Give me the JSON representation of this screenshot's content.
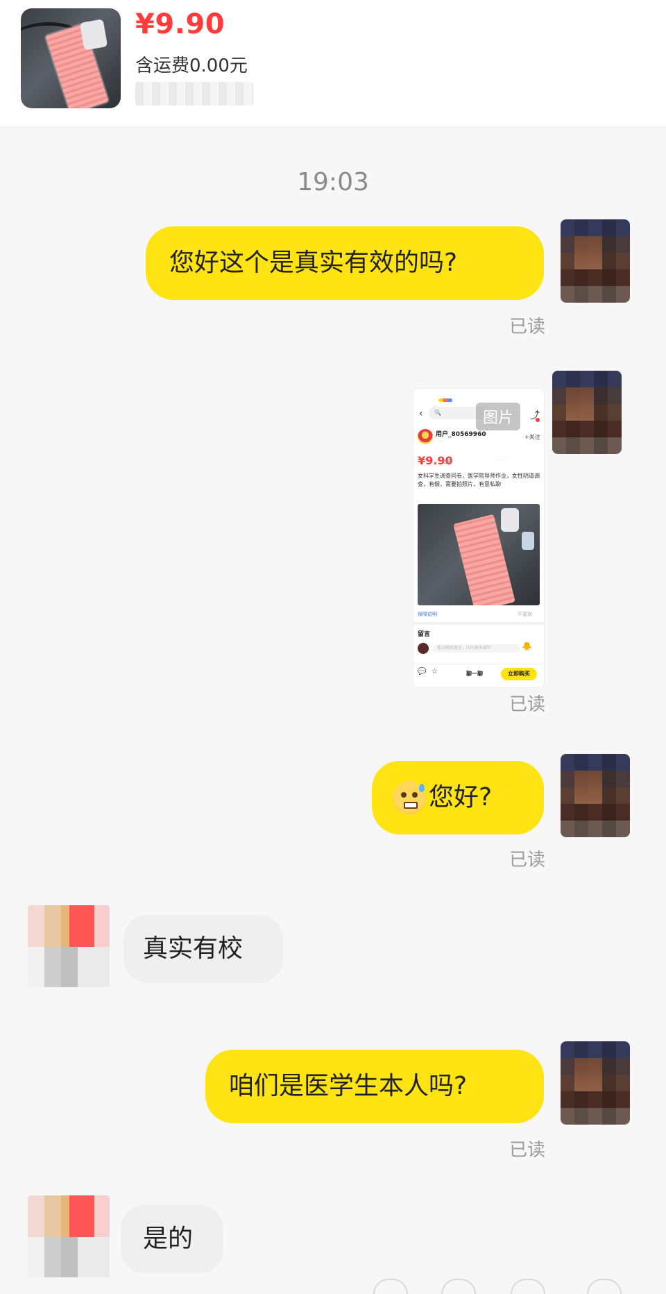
{
  "product": {
    "price": "¥9.90",
    "shipping": "含运费0.00元"
  },
  "chat": {
    "timestamp": "19:03",
    "messages": [
      {
        "from": "me",
        "text": "您好这个是真实有效的吗?",
        "status": "已读"
      },
      {
        "from": "me",
        "type": "image",
        "tag": "图片",
        "status": "已读"
      },
      {
        "from": "me",
        "text": "您好?",
        "emoji": "anxious-sweat-face",
        "status": "已读"
      },
      {
        "from": "them",
        "text": "真实有校"
      },
      {
        "from": "me",
        "text": "咱们是医学生本人吗?",
        "status": "已读"
      },
      {
        "from": "them",
        "text": "是的"
      }
    ]
  },
  "shared_screenshot": {
    "user": "用户_80569960",
    "follow": "+关注",
    "price": "¥9.90",
    "price_sub": "包邮",
    "description": "女科学生调查问卷，医学院导师作业，女性阴道调查，有偿，需要拍照片，有意私聊",
    "link_left": "保障说明",
    "link_right": "不喜欢",
    "comments_title": "留言",
    "comment_placeholder": "看对眼就留言，问问更多细节",
    "ask_label": "聊一聊",
    "buy_label": "立即购买",
    "nav_left": "小窗",
    "nav_right": "收藏"
  },
  "colors": {
    "bubble_out": "#ffe313",
    "bubble_in": "#efefef",
    "price_red": "#ff3b3b"
  },
  "icons": [
    "anxious-sweat-face-icon",
    "back-arrow-icon",
    "share-icon",
    "comment-icon",
    "star-icon"
  ]
}
